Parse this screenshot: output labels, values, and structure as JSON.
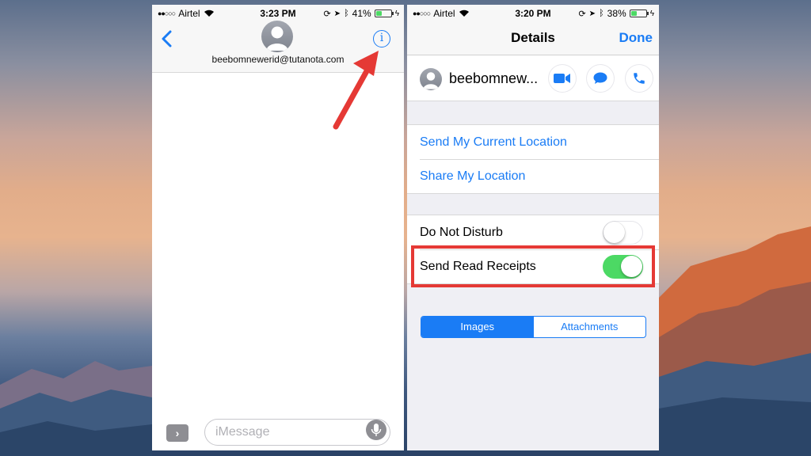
{
  "left_phone": {
    "status": {
      "carrier": "Airtel",
      "time": "3:23 PM",
      "battery": "41%",
      "battery_level": 0.41
    },
    "contact_email": "beebomnewerid@tutanota.com",
    "info_glyph": "i",
    "apps_glyph": "›",
    "message_placeholder": "iMessage"
  },
  "right_phone": {
    "status": {
      "carrier": "Airtel",
      "time": "3:20 PM",
      "battery": "38%",
      "battery_level": 0.38
    },
    "nav": {
      "title": "Details",
      "done_label": "Done"
    },
    "contact_name": "beebomnew...",
    "location_items": [
      "Send My Current Location",
      "Share My Location"
    ],
    "settings": [
      {
        "label": "Do Not Disturb",
        "on": false
      },
      {
        "label": "Send Read Receipts",
        "on": true
      }
    ],
    "segments": [
      {
        "label": "Images",
        "selected": true
      },
      {
        "label": "Attachments",
        "selected": false
      }
    ]
  },
  "colors": {
    "accent": "#1a7cf5",
    "toggle_on": "#4cd964",
    "annotation": "#e53935"
  }
}
